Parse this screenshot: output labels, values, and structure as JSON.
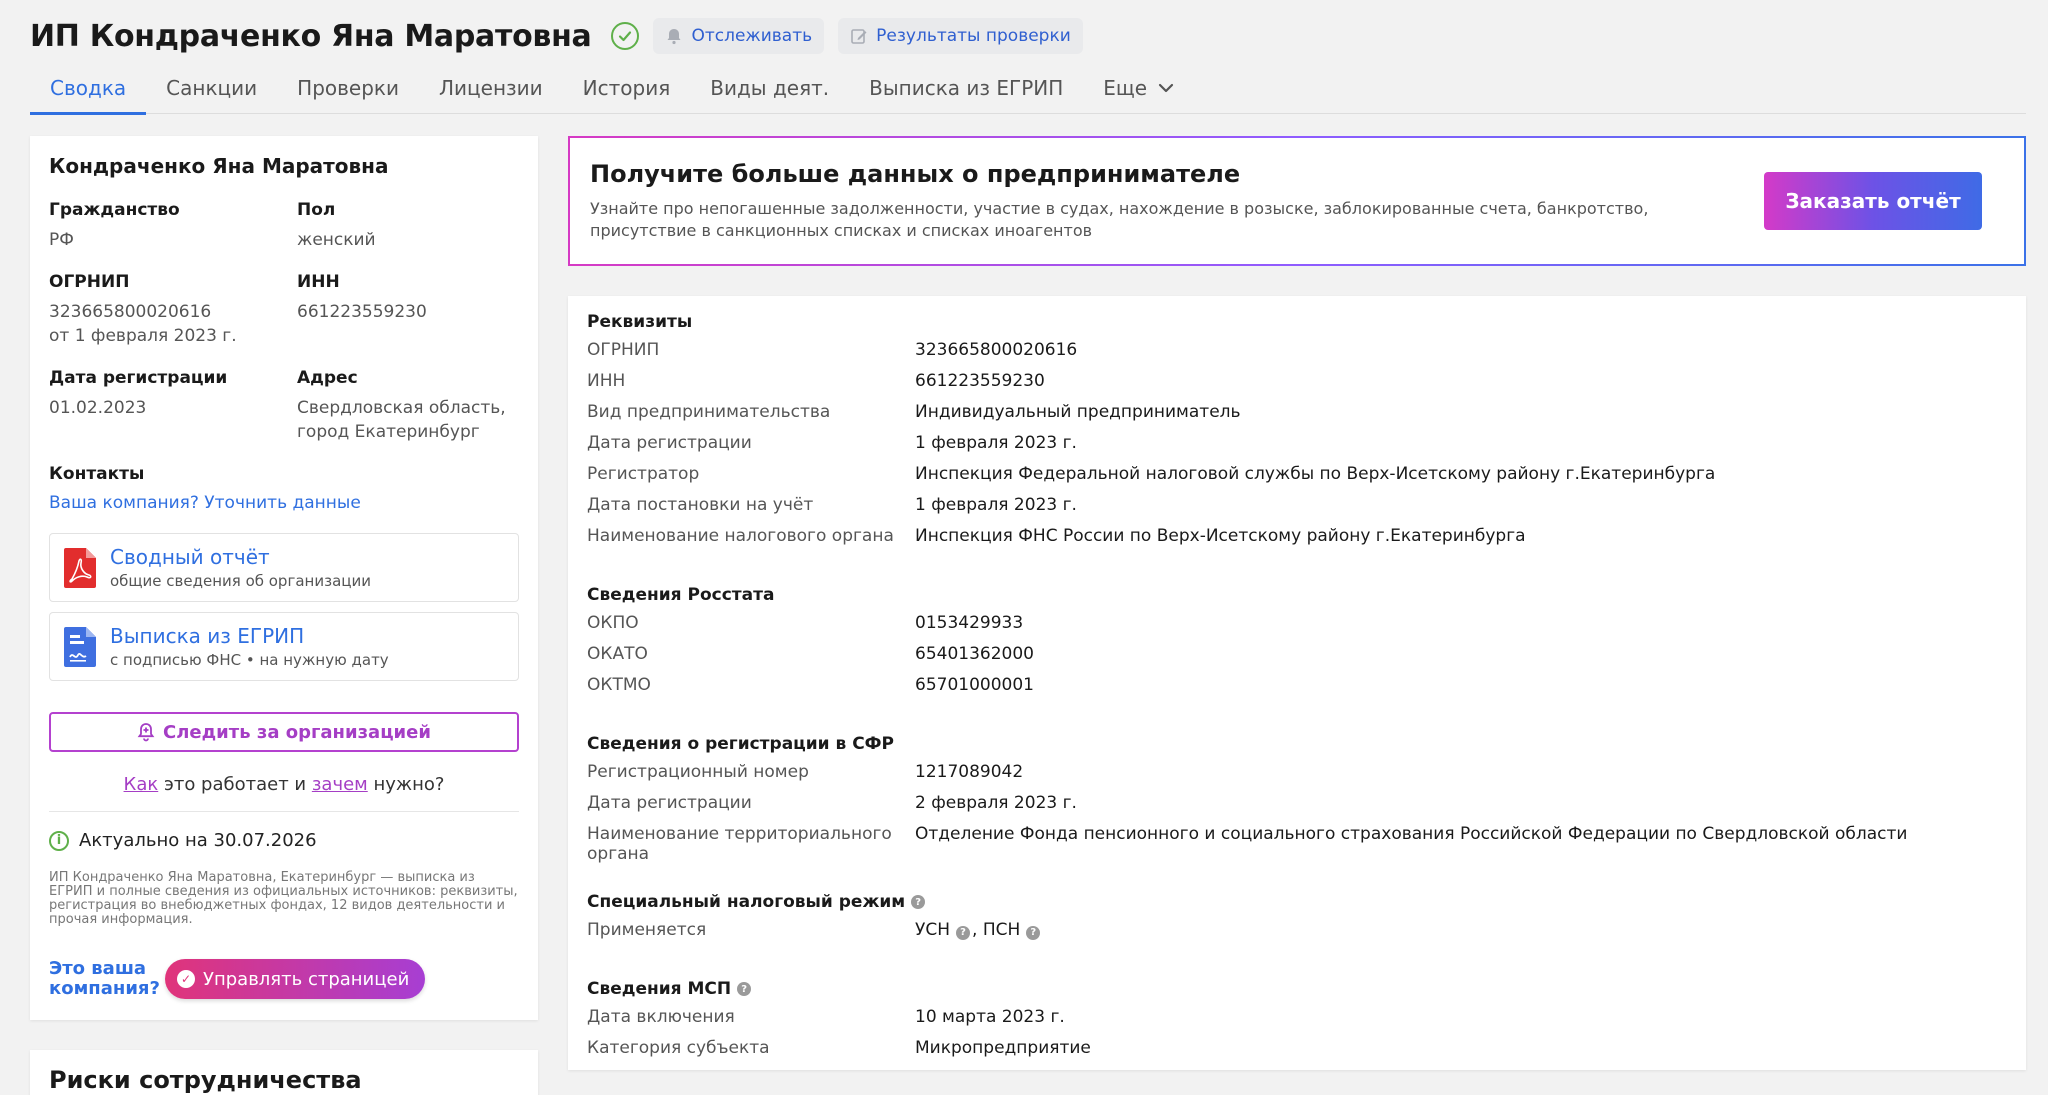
{
  "header": {
    "title": "ИП Кондраченко Яна Маратовна",
    "track_label": "Отслеживать",
    "check_label": "Результаты проверки"
  },
  "tabs": [
    {
      "label": "Сводка",
      "active": true
    },
    {
      "label": "Санкции"
    },
    {
      "label": "Проверки"
    },
    {
      "label": "Лицензии"
    },
    {
      "label": "История"
    },
    {
      "label": "Виды деят."
    },
    {
      "label": "Выписка из ЕГРИП"
    },
    {
      "label": "Еще"
    }
  ],
  "left": {
    "name": "Кондраченко Яна Маратовна",
    "citizenship_label": "Гражданство",
    "citizenship": "РФ",
    "sex_label": "Пол",
    "sex": "женский",
    "ogrnip_label": "ОГРНИП",
    "ogrnip": "323665800020616",
    "ogrnip_date": "от 1 февраля 2023 г.",
    "inn_label": "ИНН",
    "inn": "661223559230",
    "reg_date_label": "Дата регистрации",
    "reg_date": "01.02.2023",
    "address_label": "Адрес",
    "address": "Свердловская область, город Екатеринбург",
    "contacts_label": "Контакты",
    "contacts_link": "Ваша компания? Уточнить данные",
    "doc1_title": "Сводный отчёт",
    "doc1_sub": "общие сведения об организации",
    "doc2_title": "Выписка из ЕГРИП",
    "doc2_sub": "с подписью ФНС • на нужную дату",
    "follow_label": "Следить за организацией",
    "how_1": "Как",
    "how_2": " это работает и ",
    "how_3": "зачем",
    "how_4": " нужно?",
    "actual": "Актуально на 30.07.2026",
    "note": "ИП Кондраченко Яна Маратовна, Екатеринбург — выписка из ЕГРИП и полные сведения из официальных источников: реквизиты, регистрация во внебюджетных фондах, 12 видов деятельности и прочая информация.",
    "own_question": "Это ваша компания?",
    "manage_label": "Управлять страницей"
  },
  "risks": {
    "title": "Риски сотрудничества"
  },
  "promo": {
    "title": "Получите больше данных о предпринимателе",
    "text": "Узнайте про непогашенные задолженности, участие в судах, нахождение в розыске, заблокированные счета, банкротство, присутствие в санкционных списках и списках иноагентов",
    "button": "Заказать отчёт"
  },
  "requisites": {
    "title": "Реквизиты",
    "rows": [
      {
        "k": "ОГРНИП",
        "v": "323665800020616"
      },
      {
        "k": "ИНН",
        "v": "661223559230"
      },
      {
        "k": "Вид предпринимательства",
        "v": "Индивидуальный предприниматель"
      },
      {
        "k": "Дата регистрации",
        "v": "1 февраля 2023 г."
      },
      {
        "k": "Регистратор",
        "v": "Инспекция Федеральной налоговой службы по Верх-Исетскому району г.Екатеринбурга"
      },
      {
        "k": "Дата постановки на учёт",
        "v": "1 февраля 2023 г."
      },
      {
        "k": "Наименование налогового органа",
        "v": "Инспекция ФНС России по Верх-Исетскому району г.Екатеринбурга"
      }
    ]
  },
  "rosstat": {
    "title": "Сведения Росстата",
    "rows": [
      {
        "k": "ОКПО",
        "v": "0153429933"
      },
      {
        "k": "ОКАТО",
        "v": "65401362000"
      },
      {
        "k": "ОКТМО",
        "v": "65701000001"
      }
    ]
  },
  "sfr": {
    "title": "Сведения о регистрации в СФР",
    "rows": [
      {
        "k": "Регистрационный номер",
        "v": "1217089042"
      },
      {
        "k": "Дата регистрации",
        "v": "2 февраля 2023 г."
      },
      {
        "k": "Наименование территориального органа",
        "v": "Отделение Фонда пенсионного и социального страхования Российской Федерации по Свердловской области"
      }
    ]
  },
  "tax_regime": {
    "title": "Специальный налоговый режим",
    "row_label": "Применяется",
    "usn": "УСН",
    "sep": ", ",
    "psn": "ПСН"
  },
  "msp": {
    "title": "Сведения МСП",
    "rows": [
      {
        "k": "Дата включения",
        "v": "10 марта 2023 г."
      },
      {
        "k": "Категория субъекта",
        "v": "Микропредприятие"
      }
    ]
  },
  "colors": {
    "accent_blue": "#2f6fe0",
    "accent_purple": "#a53ec5",
    "verified_green": "#5fb04a",
    "pdf_red": "#e22d2d"
  }
}
